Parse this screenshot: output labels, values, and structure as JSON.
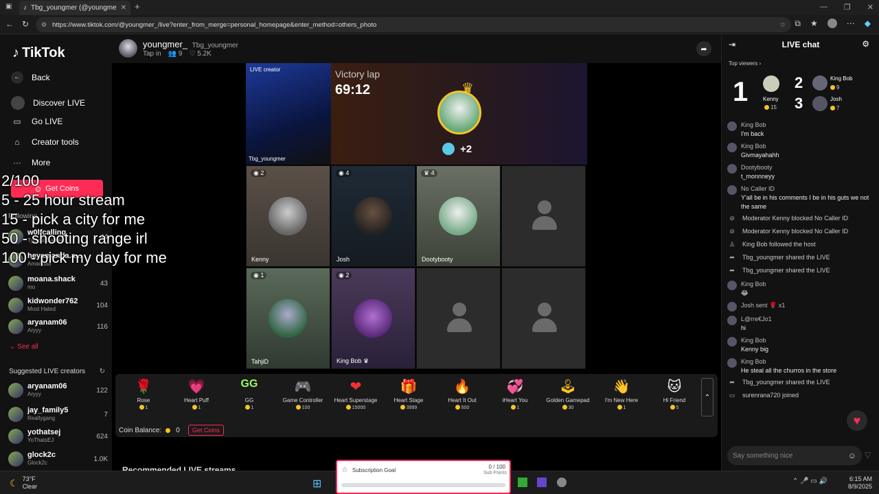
{
  "browser": {
    "tab_title": "Tbg_youngmer (@youngmer_...",
    "url": "https://www.tiktok.com/@youngmer_/live?enter_from_merge=personal_homepage&enter_method=others_photo"
  },
  "sidebar": {
    "logo": "TikTok",
    "back": "Back",
    "nav": [
      "Discover LIVE",
      "Go LIVE",
      "Creator tools",
      "More"
    ],
    "get_coins": "Get Coins",
    "following_heading": "Following",
    "following": [
      {
        "name": "w0lfcalling",
        "sub": "Typical Gamer",
        "count": "44"
      },
      {
        "name": "heyamanda.a...",
        "sub": "Amandaa",
        "count": "43"
      },
      {
        "name": "moana.shack",
        "sub": "mo",
        "count": "43"
      },
      {
        "name": "kidwonder762",
        "sub": "Most Hated",
        "count": "104"
      },
      {
        "name": "aryanam06",
        "sub": "Aryyy",
        "count": "116"
      }
    ],
    "see_all": "See all",
    "suggested_heading": "Suggested LIVE creators",
    "suggested": [
      {
        "name": "aryanam06",
        "sub": "Aryyy",
        "count": "122"
      },
      {
        "name": "jay_family5",
        "sub": "Reallygang",
        "count": "7"
      },
      {
        "name": "yothatsej",
        "sub": "YoThatsEJ",
        "count": "624"
      },
      {
        "name": "glock2c",
        "sub": "Glock2c",
        "count": "1.0K"
      }
    ]
  },
  "overlay_lines": [
    "2/100",
    "5 - 25 hour stream",
    "15 - pick a city for me",
    "50 - shooting range irl",
    "100 - pick my day for me"
  ],
  "stream": {
    "host_name": "youngmer_",
    "host_handle": "Tbg_youngmer",
    "tap_in": "Tap in",
    "viewers": "9",
    "likes": "5.2K",
    "live_creator_label": "LIVE creator",
    "host_cell_name": "Tbg_youngmer",
    "victory_title": "Victory lap",
    "victory_timer": "69:12",
    "victory_bonus": "+2",
    "guests": [
      {
        "name": "Kenny",
        "badge": "2"
      },
      {
        "name": "Josh",
        "badge": "4"
      },
      {
        "name": "Dootybooty",
        "badge": "4"
      },
      {
        "name": "",
        "badge": ""
      },
      {
        "name": "TahjiD",
        "badge": "1"
      },
      {
        "name": "King Bob",
        "badge": "2"
      },
      {
        "name": "",
        "badge": ""
      },
      {
        "name": "",
        "badge": ""
      }
    ]
  },
  "gifts": [
    {
      "name": "Rose",
      "price": "1",
      "icon": "🌹"
    },
    {
      "name": "Heart Puff",
      "price": "1",
      "icon": "💗"
    },
    {
      "name": "GG",
      "price": "1",
      "icon": "GG"
    },
    {
      "name": "Game Controller",
      "price": "100",
      "icon": "🎮"
    },
    {
      "name": "Heart Superstage",
      "price": "15000",
      "icon": "❤"
    },
    {
      "name": "Heart Stage",
      "price": "3999",
      "icon": "🎁"
    },
    {
      "name": "Heart It Out",
      "price": "500",
      "icon": "🔥"
    },
    {
      "name": "iHeart You",
      "price": "1",
      "icon": "💞"
    },
    {
      "name": "Golden Gamepad",
      "price": "30",
      "icon": "🕹"
    },
    {
      "name": "I'm New Here",
      "price": "1",
      "icon": "👋"
    },
    {
      "name": "Hi Friend",
      "price": "5",
      "icon": "🐱"
    }
  ],
  "coin_balance_label": "Coin Balance:",
  "coin_balance_value": "0",
  "coin_get": "Get Coins",
  "recommended_heading": "Recommended LIVE streams",
  "chat": {
    "title": "LIVE chat",
    "top_viewers_label": "Top viewers",
    "top": [
      {
        "rank": "1",
        "name": "Kenny",
        "coins": "15"
      },
      {
        "rank": "2",
        "name": "King Bob",
        "coins": "9"
      },
      {
        "rank": "3",
        "name": "Josh",
        "coins": "7"
      }
    ],
    "messages": [
      {
        "type": "msg",
        "user": "King Bob",
        "text": "I'm back"
      },
      {
        "type": "msg",
        "user": "King Bob",
        "text": "Givmayahahh"
      },
      {
        "type": "msg",
        "user": "Dootybooty",
        "text": "t_monnneyy"
      },
      {
        "type": "msg",
        "user": "No Caller ID",
        "text": "Y'all be in his comments I be in his guts we not the same"
      },
      {
        "type": "sys",
        "user": "",
        "text": "Moderator Kenny  blocked No Caller ID"
      },
      {
        "type": "sys",
        "user": "",
        "text": "Moderator Kenny  blocked No Caller ID"
      },
      {
        "type": "sys",
        "user": "",
        "text": "King Bob  followed the host"
      },
      {
        "type": "sys",
        "user": "",
        "text": "Tbg_youngmer shared the LIVE"
      },
      {
        "type": "sys",
        "user": "",
        "text": "Tbg_youngmer shared the LIVE"
      },
      {
        "type": "msg",
        "user": "King Bob",
        "text": "😂"
      },
      {
        "type": "msg",
        "user": "Josh sent 🌹 x1",
        "text": ""
      },
      {
        "type": "msg",
        "user": "L@rre€Jo1",
        "text": "hi"
      },
      {
        "type": "msg",
        "user": "King Bob",
        "text": "Kenny big"
      },
      {
        "type": "msg",
        "user": "King Bob",
        "text": "He steal all the churros in the store"
      },
      {
        "type": "sys",
        "user": "",
        "text": "Tbg_youngmer shared the LIVE"
      },
      {
        "type": "sys",
        "user": "",
        "text": "surenrana720 joined"
      }
    ],
    "input_placeholder": "Say something nice"
  },
  "subscription": {
    "title": "Subscription Goal",
    "progress": "0 / 100",
    "unit": "Sub Points",
    "fill": 0
  },
  "taskbar": {
    "temp": "73°F",
    "weather": "Clear",
    "time": "6:15 AM",
    "date": "8/9/2025"
  }
}
